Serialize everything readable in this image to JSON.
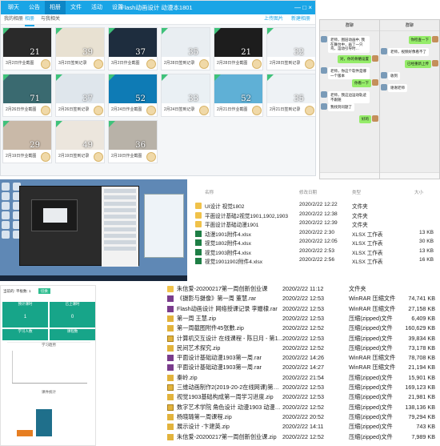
{
  "album": {
    "tabs": [
      "聊天",
      "公告",
      "相册",
      "文件",
      "活动",
      "设置"
    ],
    "active_tab": "相册",
    "title": "Flash动画设计 动漫本1801",
    "window_controls": "— □ ×",
    "subtabs": [
      "我的相册",
      "相册",
      "与我相关"
    ],
    "actions": [
      "上传图片",
      "新建相册"
    ],
    "photos": [
      {
        "num": "21",
        "caption": "3月2日作业截图",
        "color": "#2a2a2a"
      },
      {
        "num": "39",
        "caption": "3月2日签到记录",
        "color": "#e8e1d2"
      },
      {
        "num": "37",
        "caption": "3月2日作业截图",
        "color": "#1e2d3e"
      },
      {
        "num": "35",
        "caption": "2月28日签到记录",
        "color": "#e9eef2"
      },
      {
        "num": "21",
        "caption": "2月28日作业截图",
        "color": "#1d1d1d"
      },
      {
        "num": "32",
        "caption": "2月28日签到记录",
        "color": "#eef1f4"
      },
      {
        "num": "71",
        "caption": "2月26日作业截图",
        "color": "#3a6a70"
      },
      {
        "num": "37",
        "caption": "2月26日签到记录",
        "color": "#dfe6ec"
      },
      {
        "num": "52",
        "caption": "2月24日作业截图",
        "color": "#0e7bb5"
      },
      {
        "num": "33",
        "caption": "2月24日签到记录",
        "color": "#eaf0f4"
      },
      {
        "num": "52",
        "caption": "2月21日作业截图",
        "color": "#5fb0d6"
      },
      {
        "num": "35",
        "caption": "2月21日签到记录",
        "color": "#eef2f5"
      },
      {
        "num": "29",
        "caption": "2月19日作业截图",
        "color": "#c9b9a8"
      },
      {
        "num": "49",
        "caption": "2月19日签到记录",
        "color": "#ece6dd"
      },
      {
        "num": "36",
        "caption": "2月19日作业截图",
        "color": "#b8b2a8"
      }
    ]
  },
  "chat": {
    "left_header": "群聊",
    "right_header": "群聊",
    "left_messages": [
      {
        "side": "l",
        "text": "老师，图层动画中, 我在舞台中，画了一只鸟，运动引导时…"
      },
      {
        "side": "r",
        "text": "对，你的骨骼设置"
      },
      {
        "side": "l",
        "text": "老师，你这个软件是哪一个版本"
      },
      {
        "side": "r",
        "text": "你看一下"
      },
      {
        "side": "l",
        "text": "老师，我这边运动轨迹不跟随"
      },
      {
        "side": "l",
        "text": "我找到问题了"
      },
      {
        "side": "r",
        "text": "好的"
      }
    ],
    "right_messages": [
      {
        "side": "r",
        "text": "你检查一下"
      },
      {
        "side": "l",
        "text": "老师，视频好像看不了"
      },
      {
        "side": "r",
        "text": "已经重新上传"
      },
      {
        "side": "l",
        "text": "收到"
      },
      {
        "side": "l",
        "text": "谢谢老师"
      }
    ]
  },
  "dashboard": {
    "top_label": "当前的: 平板数: 1",
    "badge": "切换",
    "tiles": [
      {
        "label": "预计课时",
        "value": "1",
        "color": "#17a589"
      },
      {
        "label": "已上课时",
        "value": "0",
        "color": "#17a589"
      },
      {
        "label": "学习人数",
        "value": "1",
        "color": "#17a589"
      },
      {
        "label": "课程数",
        "value": "0",
        "color": "#17a589"
      }
    ],
    "chart1_title": "学习趋势",
    "chart2_title": "课件统计"
  },
  "files_top": {
    "header": [
      "名称",
      "修改日期",
      "类型",
      "大小"
    ],
    "rows": [
      {
        "name": "UI设计 视觉1802",
        "date": "2020/2/22 12:22",
        "type": "文件夹",
        "size": "",
        "icon": "folder"
      },
      {
        "name": "平面设计基础2视觉1901,1902,1903",
        "date": "2020/2/22 12:38",
        "type": "文件夹",
        "size": "",
        "icon": "folder"
      },
      {
        "name": "平面设计基础动漫1901",
        "date": "2020/2/22 12:39",
        "type": "文件夹",
        "size": "",
        "icon": "folder"
      },
      {
        "name": "动漫1901附件4.xlsx",
        "date": "2020/2/22 2:30",
        "type": "XLSX 工作表",
        "size": "13 KB",
        "icon": "xlsx"
      },
      {
        "name": "视觉1802附件4.xlsx",
        "date": "2020/2/22 12:05",
        "type": "XLSX 工作表",
        "size": "30 KB",
        "icon": "xlsx"
      },
      {
        "name": "视觉1903附件4.xlsx",
        "date": "2020/2/22 2:53",
        "type": "XLSX 工作表",
        "size": "13 KB",
        "icon": "xlsx"
      },
      {
        "name": "视觉19011902附件4.xlsx",
        "date": "2020/2/22 2:56",
        "type": "XLSX 工作表",
        "size": "16 KB",
        "icon": "xlsx"
      }
    ]
  },
  "files_bottom": {
    "rows": [
      {
        "name": "朱信爱-20200217第一周创新创业课",
        "date": "2020/2/22 11:12",
        "type": "文件夹",
        "size": "",
        "icon": "folder"
      },
      {
        "name": "《摄影与摄像》第一周 董慧.rar",
        "date": "2020/2/22 12:53",
        "type": "WinRAR 压缩文件",
        "size": "74,741 KB",
        "icon": "rar"
      },
      {
        "name": "Flash动画设计 网络授课记录 李姗棣.rar",
        "date": "2020/2/22 12:53",
        "type": "WinRAR 压缩文件",
        "size": "27,158 KB",
        "icon": "rar"
      },
      {
        "name": "第一周 王慧.zip",
        "date": "2020/2/22 12:53",
        "type": "压缩(zipped)文件",
        "size": "6,409 KB",
        "icon": "zip"
      },
      {
        "name": "第一周截图附件45张數.zip",
        "date": "2020/2/22 12:52",
        "type": "压缩(zipped)文件",
        "size": "160,629 KB",
        "icon": "zip"
      },
      {
        "name": "计算机交互设计 在线课程 - 陈日月 - 第1…",
        "date": "2020/2/22 12:53",
        "type": "压缩(zipped)文件",
        "size": "39,834 KB",
        "icon": "zipg"
      },
      {
        "name": "民间艺术探究.zip",
        "date": "2020/2/22 12:52",
        "type": "压缩(zipped)文件",
        "size": "73,178 KB",
        "icon": "zip"
      },
      {
        "name": "平面设计基础动漫1903第一周.rar",
        "date": "2020/2/22 14:26",
        "type": "WinRAR 压缩文件",
        "size": "78,708 KB",
        "icon": "rar"
      },
      {
        "name": "平面设计基础动漫1903第一周.rar",
        "date": "2020/2/22 14:27",
        "type": "WinRAR 压缩文件",
        "size": "21,194 KB",
        "icon": "rar"
      },
      {
        "name": "秦岭.zip",
        "date": "2020/2/22 21:54",
        "type": "压缩(zipped)文件",
        "size": "15,901 KB",
        "icon": "zip"
      },
      {
        "name": "三维动画制作2(2019-20-2在线网课)第…",
        "date": "2020/2/22 12:53",
        "type": "压缩(zipped)文件",
        "size": "169,123 KB",
        "icon": "zipg"
      },
      {
        "name": "视觉1903基础构成第一周学习进度.zip",
        "date": "2020/2/22 12:53",
        "type": "压缩(zipped)文件",
        "size": "21,981 KB",
        "icon": "zip"
      },
      {
        "name": "数字艺术学院 角色设计 动漫1903 动漫…",
        "date": "2020/2/22 12:52",
        "type": "压缩(zipped)文件",
        "size": "138,136 KB",
        "icon": "zipg"
      },
      {
        "name": "杨晓璐第一周课程.zip",
        "date": "2020/2/22 20:52",
        "type": "压缩(zipped)文件",
        "size": "79,294 KB",
        "icon": "zip"
      },
      {
        "name": "展示设计 -卞建英.zip",
        "date": "2020/2/22 14:11",
        "type": "压缩(zipped)文件",
        "size": "743 KB",
        "icon": "zip"
      },
      {
        "name": "朱信爱-20200217第一周创新创业课.zip",
        "date": "2020/2/22 12:52",
        "type": "压缩(zipped)文件",
        "size": "7,989 KB",
        "icon": "zip"
      }
    ]
  }
}
